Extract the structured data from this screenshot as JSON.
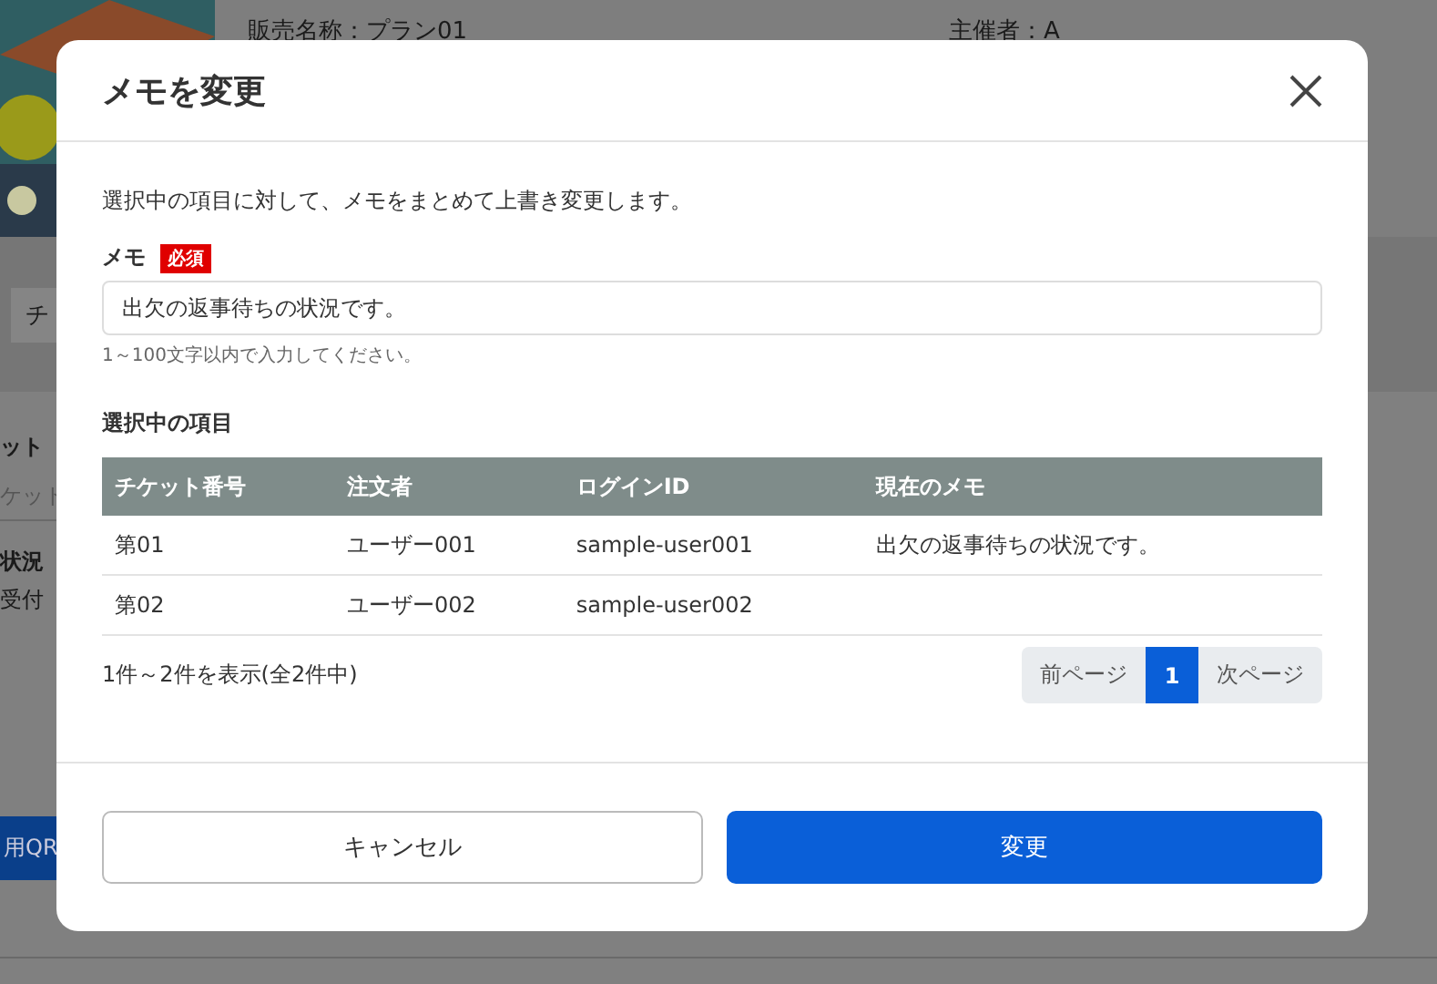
{
  "background": {
    "plan_name": "販売名称：プラン01",
    "organizer": "主催者：A",
    "tab": "チ",
    "field_label": "ット",
    "field_placeholder": "ケット",
    "status_label": "状況",
    "status_value": "受付",
    "qr_button": "用QR"
  },
  "modal": {
    "title": "メモを変更",
    "description": "選択中の項目に対して、メモをまとめて上書き変更します。",
    "memo_label": "メモ",
    "required_badge": "必須",
    "memo_value": "出欠の返事待ちの状況です。",
    "hint": "1～100文字以内で入力してください。",
    "section_title": "選択中の項目",
    "table": {
      "columns": [
        "チケット番号",
        "注文者",
        "ログインID",
        "現在のメモ"
      ],
      "rows": [
        {
          "cells": [
            "第01",
            "ユーザー001",
            "sample-user001",
            "出欠の返事待ちの状況です。"
          ]
        },
        {
          "cells": [
            "第02",
            "ユーザー002",
            "sample-user002",
            ""
          ]
        }
      ]
    },
    "range": "1件～2件を表示(全2件中)",
    "pagination": {
      "prev": "前ページ",
      "pages": [
        {
          "label": "1",
          "selected": true
        }
      ],
      "next": "次ページ"
    },
    "cancel_button": "キャンセル",
    "submit_button": "変更"
  }
}
